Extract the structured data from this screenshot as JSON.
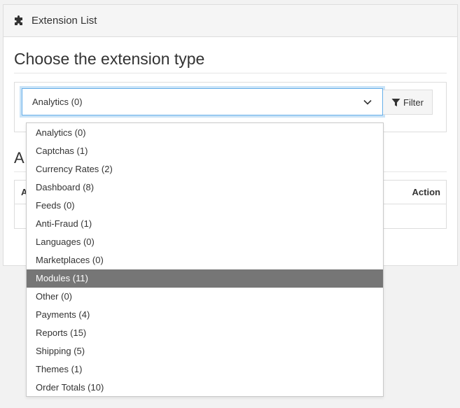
{
  "panel": {
    "title": "Extension List",
    "icon": "puzzle-icon"
  },
  "section": {
    "title": "Choose the extension type",
    "obscured_heading_fragment": "A",
    "table": {
      "header_left_fragment": "A",
      "header_action": "Action"
    }
  },
  "select": {
    "value": "Analytics (0)",
    "options": [
      "Analytics (0)",
      "Captchas (1)",
      "Currency Rates (2)",
      "Dashboard (8)",
      "Feeds (0)",
      "Anti-Fraud (1)",
      "Languages (0)",
      "Marketplaces (0)",
      "Modules (11)",
      "Other (0)",
      "Payments (4)",
      "Reports (15)",
      "Shipping (5)",
      "Themes (1)",
      "Order Totals (10)"
    ],
    "highlighted_index": 8
  },
  "filter_button": {
    "label": "Filter",
    "icon": "filter-icon"
  },
  "colors": {
    "focus_border": "#66afe9",
    "highlight_bg": "#767676",
    "panel_heading_bg": "#f5f5f5"
  }
}
